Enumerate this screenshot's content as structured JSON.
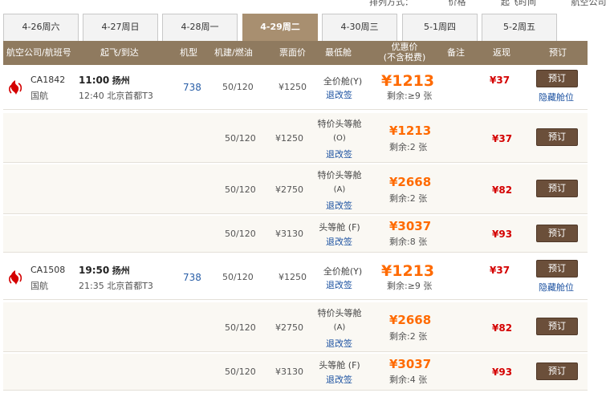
{
  "sort_strip": {
    "a": "排列方式：",
    "b": "价格",
    "c": "起飞时间",
    "d": "航空公司"
  },
  "tabs": [
    {
      "label": "4-26周六",
      "active": false
    },
    {
      "label": "4-27周日",
      "active": false
    },
    {
      "label": "4-28周一",
      "active": false
    },
    {
      "label": "4-29周二",
      "active": true
    },
    {
      "label": "4-30周三",
      "active": false
    },
    {
      "label": "5-1周四",
      "active": false
    },
    {
      "label": "5-2周五",
      "active": false
    }
  ],
  "header": {
    "airline": "航空公司/航班号",
    "times": "起飞/到达",
    "plane": "机型",
    "tax": "机建/燃油",
    "price": "票面价",
    "lowest": "最低舱",
    "discount_line1": "优惠价",
    "discount_line2": "(不含税费)",
    "note": "备注",
    "rebate": "返现",
    "book": "预订"
  },
  "flights": [
    {
      "flight_no": "CA1842",
      "airline": "国航",
      "dep_time": "11:00",
      "dep_city": "扬州",
      "arr_time": "12:40",
      "arr_airport": "北京首都T3",
      "plane": "738",
      "tax": "50/120",
      "price": "¥1250",
      "cabin": "全价舱(Y)",
      "change": "退改签",
      "disc": "¥1213",
      "remain": "剩余:≥9 张",
      "rebate": "¥37",
      "book": "预订",
      "hide": "隐藏舱位",
      "subs": [
        {
          "tax": "50/120",
          "price": "¥1250",
          "cabin": "特价头等舱",
          "code": "(O)",
          "change": "退改签",
          "disc": "¥1213",
          "remain": "剩余:2 张",
          "rebate": "¥37",
          "book": "预订"
        },
        {
          "tax": "50/120",
          "price": "¥2750",
          "cabin": "特价头等舱",
          "code": "(A)",
          "change": "退改签",
          "disc": "¥2668",
          "remain": "剩余:2 张",
          "rebate": "¥82",
          "book": "预订"
        },
        {
          "tax": "50/120",
          "price": "¥3130",
          "cabin": "头等舱 (F)",
          "code": "",
          "change": "退改签",
          "disc": "¥3037",
          "remain": "剩余:8 张",
          "rebate": "¥93",
          "book": "预订"
        }
      ]
    },
    {
      "flight_no": "CA1508",
      "airline": "国航",
      "dep_time": "19:50",
      "dep_city": "扬州",
      "arr_time": "21:35",
      "arr_airport": "北京首都T3",
      "plane": "738",
      "tax": "50/120",
      "price": "¥1250",
      "cabin": "全价舱(Y)",
      "change": "退改签",
      "disc": "¥1213",
      "remain": "剩余:≥9 张",
      "rebate": "¥37",
      "book": "预订",
      "hide": "隐藏舱位",
      "subs": [
        {
          "tax": "50/120",
          "price": "¥2750",
          "cabin": "特价头等舱",
          "code": "(A)",
          "change": "退改签",
          "disc": "¥2668",
          "remain": "剩余:2 张",
          "rebate": "¥82",
          "book": "预订"
        },
        {
          "tax": "50/120",
          "price": "¥3130",
          "cabin": "头等舱 (F)",
          "code": "",
          "change": "退改签",
          "disc": "¥3037",
          "remain": "剩余:4 张",
          "rebate": "¥93",
          "book": "预订"
        }
      ]
    }
  ],
  "colors": {
    "header_bg": "#8f7a5f",
    "active_tab": "#a88f70",
    "discount": "#ff6a00",
    "rebate": "#d40000",
    "link": "#1a50a0",
    "book_button": "#6b4f3a"
  },
  "icons": {
    "airline_logo": "air-china-phoenix-icon"
  }
}
